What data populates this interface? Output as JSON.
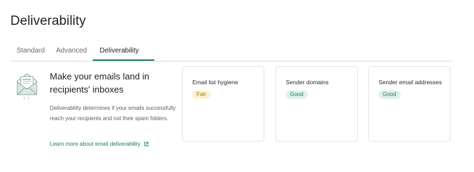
{
  "page": {
    "title": "Deliverability"
  },
  "tabs": [
    {
      "label": "Standard",
      "active": false
    },
    {
      "label": "Advanced",
      "active": false
    },
    {
      "label": "Deliverability",
      "active": true
    }
  ],
  "hero": {
    "icon": "envelope-document-icon",
    "title": "Make your emails land in recipients' inboxes",
    "description": "Deliverability determines if your emails successfully reach your recipients and not their spam folders.",
    "link_label": "Learn more about email deliverability",
    "link_icon": "external-link-icon"
  },
  "cards": [
    {
      "label": "Email list hygiene",
      "status": "Fair",
      "status_color": "#a8780d"
    },
    {
      "label": "Sender domains",
      "status": "Good",
      "status_color": "#2f7a63"
    },
    {
      "label": "Sender email addresses",
      "status": "Good",
      "status_color": "#2f7a63"
    }
  ],
  "colors": {
    "accent": "#1a7f64",
    "fair_bg": "#fdf0cf",
    "good_bg": "#dcf2ea"
  }
}
